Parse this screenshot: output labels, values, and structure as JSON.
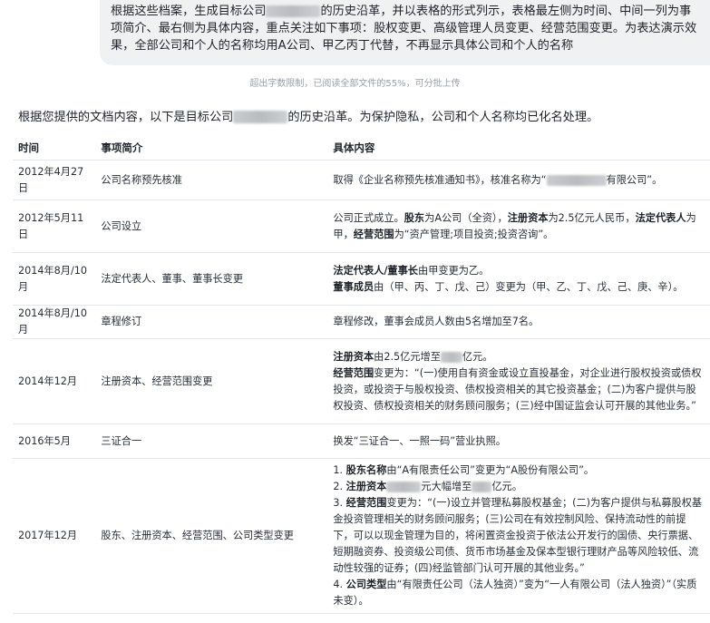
{
  "user_message": {
    "part1": "根据这些档案，生成目标公司",
    "part2": "的历史沿革，并以表格的形式列示，表格最左侧为时间、中间一列为事项简介、最右侧为具体内容，重点关注如下事项：股权变更、高级管理人员变更、经营范围变更。为表达演示效果，全部公司和个人的名称均用A公司、甲乙丙丁代替，不再显示具体公司和个人的名称"
  },
  "upload_hint": "超出字数限制，已阅读全部文件的55%，可分批上传",
  "intro": {
    "part1": "根据您提供的文档内容，以下是目标公司",
    "part2": "的历史沿革。为保护隐私，公司和个人名称均已化名处理。"
  },
  "table": {
    "headers": [
      "时间",
      "事项简介",
      "具体内容"
    ],
    "rows": [
      {
        "date": "2012年4月27日",
        "item": "公司名称预先核准",
        "detail": {
          "a": "取得《企业名称预先核准通知书》，核准名称为“",
          "b": "有限公司”。"
        }
      },
      {
        "date": "2012年5月11日",
        "item": "公司设立",
        "detail": {
          "t1": "公司正式成立。",
          "b1": "股东",
          "t2": "为A公司（全资），",
          "b2": "注册资本",
          "t3": "为2.5亿元人民币，",
          "b3": "法定代表人",
          "t4": "为甲，",
          "b4": "经营范围",
          "t5": "为“资产管理;项目投资;投资咨询”。"
        }
      },
      {
        "date": "2014年8月/10月",
        "item": "法定代表人、董事、董事长变更",
        "detail": {
          "b1": "法定代表人/董事长",
          "t1": "由甲变更为乙。",
          "b2": "董事成员",
          "t2": "由（甲、丙、丁、戊、己）变更为（甲、乙、丁、戊、己、庚、辛）。"
        }
      },
      {
        "date": "2014年8月/10月",
        "item": "章程修订",
        "detail": {
          "text": "章程修改，董事会成员人数由5名增加至7名。"
        }
      },
      {
        "date": "2014年12月",
        "item": "注册资本、经营范围变更",
        "detail": {
          "b1": "注册资本",
          "t1a": "由2.5亿元增至",
          "t1b": "亿元。",
          "b2": "经营范围",
          "t2": "变更为：“(一)使用自有资金或设立直投基金，对企业进行股权投资或债权投资，或投资于与股权投资、债权投资相关的其它投资基金；(二)为客户提供与股权投资、债权投资相关的财务顾问服务；(三)经中国证监会认可开展的其他业务。”"
        }
      },
      {
        "date": "2016年5月",
        "item": "三证合一",
        "detail": {
          "text": "换发“三证合一、一照一码”营业执照。"
        }
      },
      {
        "date": "2017年12月",
        "item": "股东、注册资本、经营范围、公司类型变更",
        "detail": {
          "n1": "1. ",
          "b1": "股东名称",
          "t1": "由“A有限责任公司”变更为“A股份有限公司”。",
          "n2": "2. ",
          "b2": "注册资本",
          "t2a": "元大幅增至",
          "t2b": "亿元。",
          "n3": "3. ",
          "b3": "经营范围",
          "t3": "变更为：“(一)设立并管理私募股权基金；(二)为客户提供与私募股权基金投资管理相关的财务顾问服务；(三)公司在有效控制风险、保持流动性的前提下，可以以现金管理为目的，将闲置资金投资于依法公开发行的国债、央行票据、短期融资券、投资级公司债、货币市场基金及保本型银行理财产品等风险较低、流动性较强的证券；(四)经监管部门认可开展的其他业务。”",
          "n4": "4. ",
          "b4": "公司类型",
          "t4": "由“有限责任公司（法人独资）”变为“一人有限公司（法人独资）”（实质未变）。"
        }
      }
    ]
  }
}
